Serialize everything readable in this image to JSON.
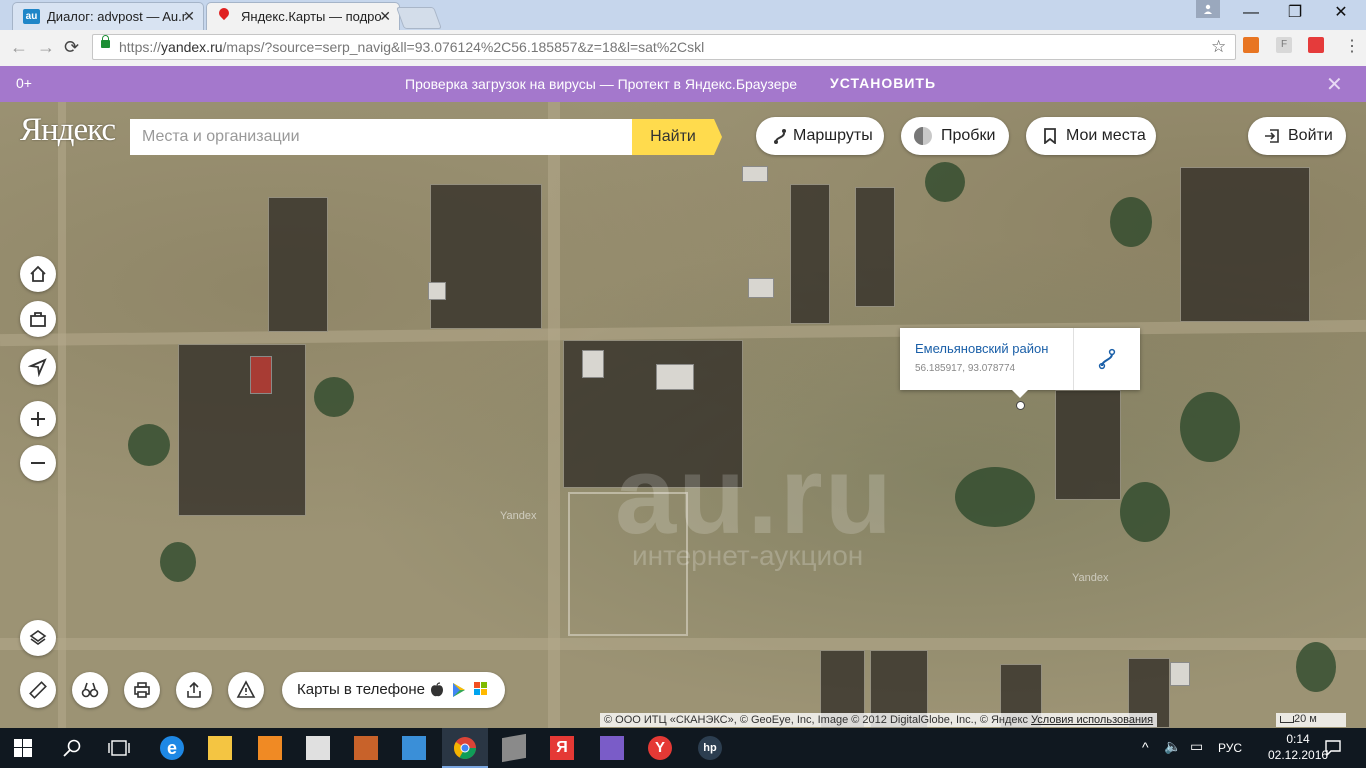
{
  "browser": {
    "tabs": [
      {
        "title": "Диалог: advpost — Au.ru",
        "favicon": "au-favicon",
        "active": false
      },
      {
        "title": "Яндекс.Карты — подробная",
        "favicon": "map-pin-favicon",
        "active": true
      }
    ],
    "address": {
      "scheme": "https://",
      "host": "yandex.ru",
      "path": "/maps/?source=serp_navig&ll=93.076124%2C56.185857&z=18&l=sat%2Cskl"
    }
  },
  "banner": {
    "age": "0+",
    "text": "Проверка загрузок на вирусы — Протект в Яндекс.Браузере",
    "install": "УСТАНОВИТЬ",
    "close": "✕",
    "color": "#a478cc"
  },
  "maps": {
    "logo": "Яндекс",
    "search_placeholder": "Места и организации",
    "find_label": "Найти",
    "routes_label": "Маршруты",
    "traffic_label": "Пробки",
    "myplaces_label": "Мои места",
    "login_label": "Войти",
    "phone_label": "Карты в телефоне",
    "popup": {
      "title": "Емельяновский район",
      "coords": "56.185917, 93.078774"
    },
    "attribution": "© ООО ИТЦ «СКАНЭКС», © GeoEye, Inc, Image © 2012 DigitalGlobe, Inc., © Яндекс",
    "terms_link": "Условия использования",
    "scale_label": "20 м",
    "watermark": {
      "main": "au.ru",
      "sub": "интернет-аукцион"
    },
    "tile_watermark": "Yandex"
  },
  "taskbar": {
    "language": "РУС",
    "time": "0:14",
    "date": "02.12.2016"
  }
}
